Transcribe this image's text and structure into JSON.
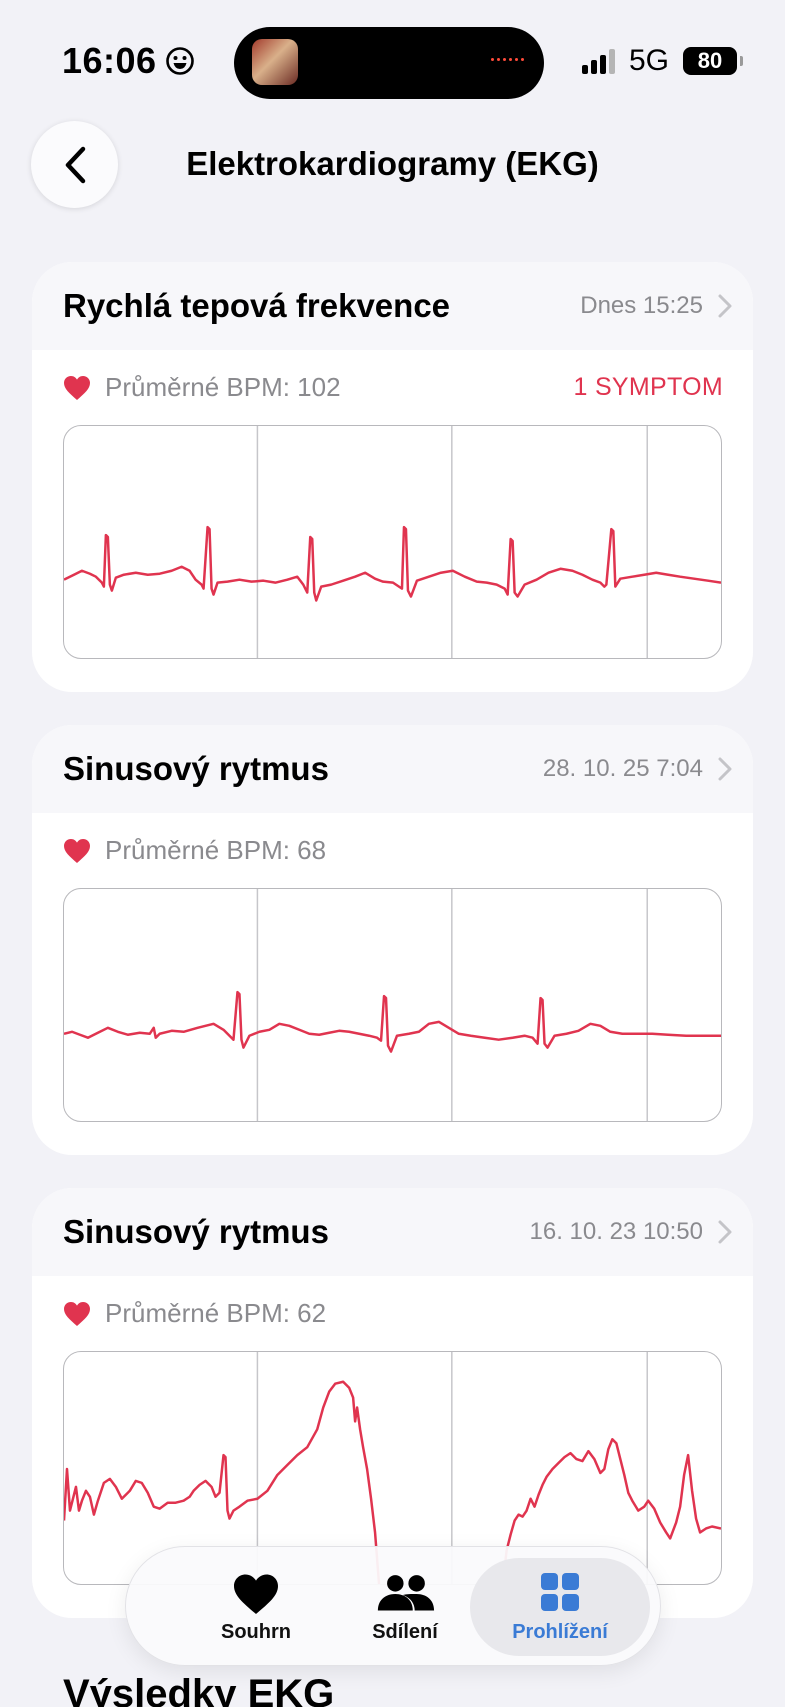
{
  "status_bar": {
    "time": "16:06",
    "network": "5G",
    "battery": "80"
  },
  "header": {
    "title": "Elektrokardiogramy (EKG)"
  },
  "cards": [
    {
      "title": "Rychlá tepová frekvence",
      "date": "Dnes 15:25",
      "bpm_label": "Průměrné BPM: 102",
      "symptom": "1 SYMPTOM"
    },
    {
      "title": "Sinusový rytmus",
      "date": "28. 10. 25 7:04",
      "bpm_label": "Průměrné BPM: 68",
      "symptom": ""
    },
    {
      "title": "Sinusový rytmus",
      "date": "16. 10. 23 10:50",
      "bpm_label": "Průměrné BPM: 62",
      "symptom": ""
    }
  ],
  "tab_bar": {
    "tabs": [
      {
        "label": "Souhrn",
        "icon": "heart-icon"
      },
      {
        "label": "Sdílení",
        "icon": "people-icon"
      },
      {
        "label": "Prohlížení",
        "icon": "grid-icon",
        "active": true
      }
    ]
  },
  "section_title": "Výsledky EKG",
  "colors": {
    "accent_red": "#e0344f",
    "tab_active": "#3a7bd5",
    "background": "#f2f2f7"
  }
}
